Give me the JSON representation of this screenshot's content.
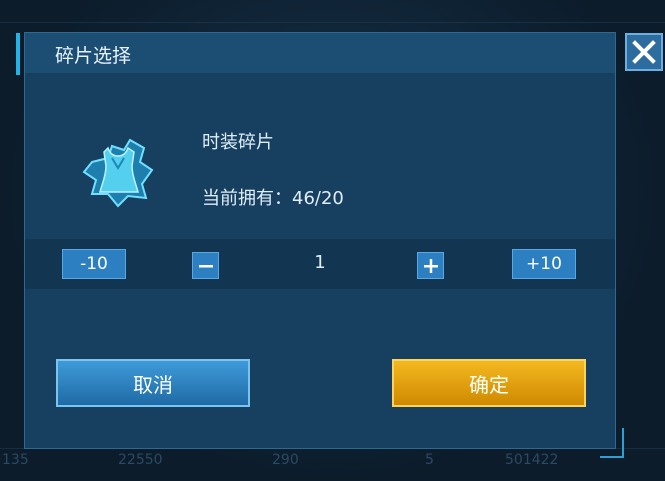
{
  "dialog": {
    "title": "碎片选择",
    "item_name": "时装碎片",
    "owned_label": "当前拥有：46/20"
  },
  "stepper": {
    "minus10_label": "-10",
    "minus_label": "−",
    "quantity": "1",
    "plus_label": "+",
    "plus10_label": "+10"
  },
  "buttons": {
    "cancel_label": "取消",
    "confirm_label": "确定"
  },
  "background_numbers": [
    "135",
    "22550",
    "290",
    "5",
    "501422"
  ],
  "icons": {
    "close": "close-icon",
    "item": "fashion-fragment-icon"
  },
  "colors": {
    "accent": "#22b4e6",
    "confirm": "#e3a210",
    "primary": "#2c80c1"
  }
}
